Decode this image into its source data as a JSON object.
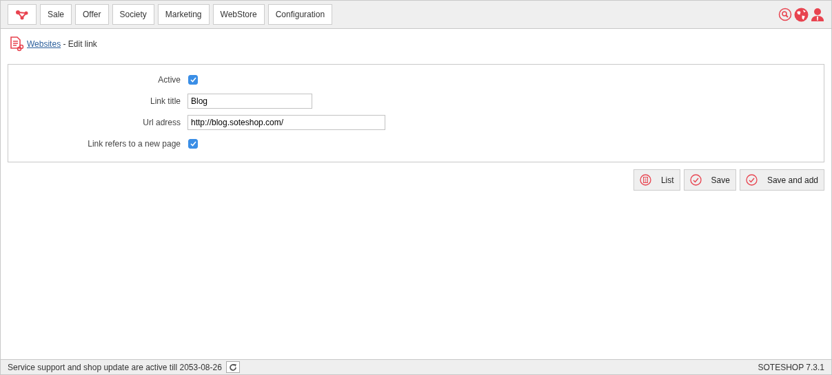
{
  "menu": [
    {
      "label": "Sale"
    },
    {
      "label": "Offer"
    },
    {
      "label": "Society"
    },
    {
      "label": "Marketing"
    },
    {
      "label": "WebStore"
    },
    {
      "label": "Configuration"
    }
  ],
  "breadcrumb": {
    "link": "Websites",
    "current": " - Edit link"
  },
  "form": [
    {
      "kind": "checkbox",
      "label": "Active",
      "checked": true
    },
    {
      "kind": "text",
      "label": "Link title",
      "value": "Blog"
    },
    {
      "kind": "url",
      "label": "Url adress",
      "value": "http://blog.soteshop.com/"
    },
    {
      "kind": "checkbox",
      "label": "Link refers to a new page",
      "checked": true
    }
  ],
  "buttons": [
    {
      "kind": "list",
      "label": "List"
    },
    {
      "kind": "check",
      "label": "Save"
    },
    {
      "kind": "check",
      "label": "Save and add"
    }
  ],
  "status_bar": {
    "message": "Service support and shop update are active till 2053-08-26",
    "version": "SOTESHOP 7.3.1"
  }
}
